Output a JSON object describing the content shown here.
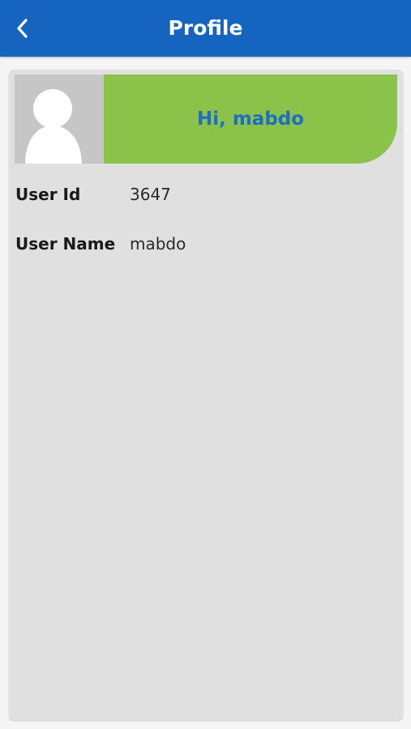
{
  "header": {
    "title": "Profile",
    "back_icon": "chevron-left-icon",
    "background_color": "#1565c0"
  },
  "profile": {
    "avatar_icon": "default-avatar-icon",
    "greeting": "Hi, mabdo",
    "greeting_color": "#1e6fbf",
    "banner_color": "#8bc34a",
    "fields": [
      {
        "label": "User Id",
        "value": "3647"
      },
      {
        "label": "User Name",
        "value": "mabdo"
      }
    ]
  }
}
